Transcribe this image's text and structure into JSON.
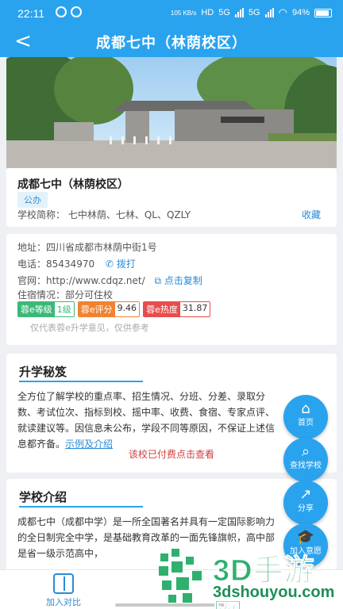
{
  "status_bar": {
    "time": "22:11",
    "network_speed": "105 KB/s",
    "hd": "HD",
    "net1": "5G",
    "net2": "5G",
    "battery": "94%"
  },
  "nav": {
    "back_glyph": "<",
    "title": "成都七中（林荫校区）"
  },
  "school": {
    "name": "成都七中（林荫校区）",
    "type_tag": "公办",
    "abbr_label": "学校简称：",
    "abbr_value": "七中林荫、七林、QL、QZLY",
    "favorite": "收藏"
  },
  "details": {
    "address_label": "地址：",
    "address": "四川省成都市林荫中街1号",
    "phone_label": "电话：",
    "phone": "85434970",
    "call_label": "拨打",
    "site_label": "官网：",
    "site": "http://www.cdqz.net/",
    "copy_label": "点击复制",
    "lodging_label": "住宿情况：",
    "lodging": "部分可住校",
    "badges": [
      {
        "key": "蓉e等级",
        "value": "1级"
      },
      {
        "key": "蓉e评分",
        "value": "9.46"
      },
      {
        "key": "蓉e热度",
        "value": "31.87"
      }
    ],
    "note": "仅代表蓉e升学意见，仅供参考"
  },
  "secrets": {
    "title": "升学秘笈",
    "text": "全方位了解学校的重点率、招生情况、分班、分差、录取分数、考试位次、指标到校、摇中率、收费、食宿、专家点评、就读建议等。因信息未公布，学段不同等原因，不保证上述信息都齐备。",
    "link": "示例及介绍",
    "pay_text": "该校已付费点击查看"
  },
  "intro": {
    "title": "学校介绍",
    "text": "成都七中（成都中学）是一所全国著名并具有一定国际影响力的全日制完全中学，是基础教育改革的一面先锋旗帜，高中部是省一级示范高中，"
  },
  "bottom": {
    "compare_label": "加入对比"
  },
  "floating": [
    {
      "icon": "home-icon",
      "glyph": "⌂",
      "label": "首页"
    },
    {
      "icon": "search-icon",
      "glyph": "⌕",
      "label": "查找学校"
    },
    {
      "icon": "share-icon",
      "glyph": "↗",
      "label": "分享"
    },
    {
      "icon": "graduation-cap-icon",
      "glyph": "🎓",
      "label": "加入意愿"
    }
  ],
  "watermark": {
    "text_cn": "3D手游网",
    "text_url": "3dshouyou.com"
  },
  "colors": {
    "primary": "#2aa3ef",
    "link": "#2a8ad6",
    "alert": "#d33c3c",
    "badge_green": "#3cb878",
    "badge_orange": "#f08232",
    "badge_red": "#e84d4d"
  }
}
